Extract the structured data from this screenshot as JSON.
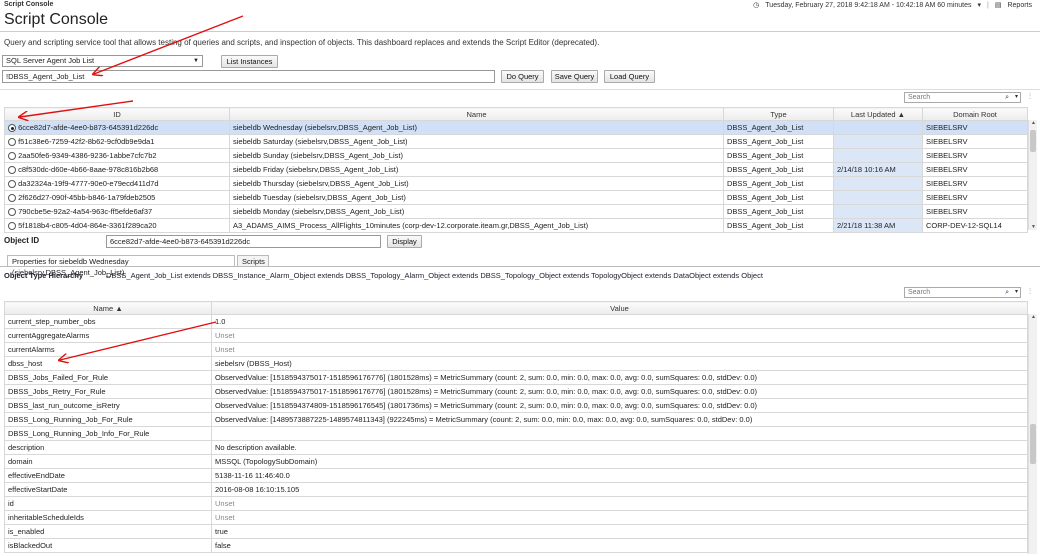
{
  "topbar": {
    "app_title": "Script Console",
    "datetime": "Tuesday, February 27, 2018 9:42:18 AM - 10:42:18 AM 60 minutes",
    "reports": "Reports"
  },
  "page": {
    "title": "Script Console",
    "description": "Query and scripting service tool that allows testing of queries and scripts, and inspection of objects. This dashboard replaces and extends the Script Editor (deprecated)."
  },
  "query": {
    "selected_query": "SQL Server Agent Job List",
    "list_instances_label": "List Instances",
    "query_text": "!DBSS_Agent_Job_List",
    "do_query_label": "Do Query",
    "save_query_label": "Save Query",
    "load_query_label": "Load Query"
  },
  "results": {
    "search_placeholder": "Search",
    "columns": [
      "ID",
      "Name",
      "Type",
      "Last Updated",
      "Domain Root"
    ],
    "sort_column": "Last Updated",
    "rows": [
      {
        "id": "6cce82d7-afde-4ee0-b873-645391d226dc",
        "name": "siebeldb Wednesday (siebelsrv,DBSS_Agent_Job_List)",
        "type": "DBSS_Agent_Job_List",
        "updated": "",
        "domain": "SIEBELSRV",
        "selected": true
      },
      {
        "id": "f51c38e6-7259-42f2-8b62-9cf0db9e9da1",
        "name": "siebeldb Saturday (siebelsrv,DBSS_Agent_Job_List)",
        "type": "DBSS_Agent_Job_List",
        "updated": "",
        "domain": "SIEBELSRV",
        "selected": false
      },
      {
        "id": "2aa50fe6-9349-4386-9236-1abbe7cfc7b2",
        "name": "siebeldb Sunday (siebelsrv,DBSS_Agent_Job_List)",
        "type": "DBSS_Agent_Job_List",
        "updated": "",
        "domain": "SIEBELSRV",
        "selected": false
      },
      {
        "id": "c8f530dc-d60e-4b66-8aae-978c816b2b68",
        "name": "siebeldb Friday (siebelsrv,DBSS_Agent_Job_List)",
        "type": "DBSS_Agent_Job_List",
        "updated": "2/14/18 10:16 AM",
        "domain": "SIEBELSRV",
        "selected": false
      },
      {
        "id": "da32324a-19f9-4777-90e0-e79ecd411d7d",
        "name": "siebeldb Thursday (siebelsrv,DBSS_Agent_Job_List)",
        "type": "DBSS_Agent_Job_List",
        "updated": "",
        "domain": "SIEBELSRV",
        "selected": false
      },
      {
        "id": "2f626d27-090f-45bb-b846-1a79fdeb2505",
        "name": "siebeldb Tuesday (siebelsrv,DBSS_Agent_Job_List)",
        "type": "DBSS_Agent_Job_List",
        "updated": "",
        "domain": "SIEBELSRV",
        "selected": false
      },
      {
        "id": "790cbe5e-92a2-4a54-963c-ff5efde6af37",
        "name": "siebeldb Monday (siebelsrv,DBSS_Agent_Job_List)",
        "type": "DBSS_Agent_Job_List",
        "updated": "",
        "domain": "SIEBELSRV",
        "selected": false
      },
      {
        "id": "5f1818b4-c805-4d04-864e-3361f289ca20",
        "name": "A3_ADAMS_AIMS_Process_AllFlights_10minutes (corp-dev-12.corporate.iteam.gr,DBSS_Agent_Job_List)",
        "type": "DBSS_Agent_Job_List",
        "updated": "2/21/18 11:38 AM",
        "domain": "CORP-DEV-12-SQL14",
        "selected": false
      }
    ]
  },
  "object": {
    "id_label": "Object ID",
    "id_value": "6cce82d7-afde-4ee0-b873-645391d226dc",
    "display_label": "Display",
    "tabs": [
      "Properties for siebeldb Wednesday (siebelsrv,DBSS_Agent_Job_List)",
      "Scripts"
    ],
    "hierarchy_label": "Object Type Hierarchy",
    "hierarchy": "DBSS_Agent_Job_List extends  DBSS_Instance_Alarm_Object extends  DBSS_Topology_Alarm_Object extends  DBSS_Topology_Object extends  TopologyObject extends  DataObject extends  Object"
  },
  "properties": {
    "search_placeholder": "Search",
    "columns": [
      "Name",
      "Value"
    ],
    "rows": [
      {
        "name": "current_step_number_obs",
        "value": "1.0",
        "unset": false
      },
      {
        "name": "currentAggregateAlarms",
        "value": "Unset",
        "unset": true
      },
      {
        "name": "currentAlarms",
        "value": "Unset",
        "unset": true
      },
      {
        "name": "dbss_host",
        "value": "siebelsrv (DBSS_Host)",
        "unset": false
      },
      {
        "name": "DBSS_Jobs_Failed_For_Rule",
        "value": "ObservedValue: [1518594375017-1518596176776] (1801528ms) = MetricSummary (count: 2, sum: 0.0, min: 0.0, max: 0.0, avg: 0.0, sumSquares: 0.0, stdDev: 0.0)",
        "unset": false
      },
      {
        "name": "DBSS_Jobs_Retry_For_Rule",
        "value": "ObservedValue: [1518594375017-1518596176776] (1801528ms) = MetricSummary (count: 2, sum: 0.0, min: 0.0, max: 0.0, avg: 0.0, sumSquares: 0.0, stdDev: 0.0)",
        "unset": false
      },
      {
        "name": "DBSS_last_run_outcome_isRetry",
        "value": "ObservedValue: [1518594374809-1518596176545] (1801736ms) = MetricSummary (count: 2, sum: 0.0, min: 0.0, max: 0.0, avg: 0.0, sumSquares: 0.0, stdDev: 0.0)",
        "unset": false
      },
      {
        "name": "DBSS_Long_Running_Job_For_Rule",
        "value": "ObservedValue: [1489573887225-1489574811343] (922245ms) = MetricSummary (count: 2, sum: 0.0, min: 0.0, max: 0.0, avg: 0.0, sumSquares: 0.0, stdDev: 0.0)",
        "unset": false
      },
      {
        "name": "DBSS_Long_Running_Job_Info_For_Rule",
        "value": "",
        "unset": false
      },
      {
        "name": "description",
        "value": "No description available.",
        "unset": false
      },
      {
        "name": "domain",
        "value": "MSSQL (TopologySubDomain)",
        "unset": false
      },
      {
        "name": "effectiveEndDate",
        "value": "5138-11-16 11:46:40.0",
        "unset": false
      },
      {
        "name": "effectiveStartDate",
        "value": "2016-08-08 16:10:15.105",
        "unset": false
      },
      {
        "name": "id",
        "value": "Unset",
        "unset": true
      },
      {
        "name": "inheritableScheduleIds",
        "value": "Unset",
        "unset": true
      },
      {
        "name": "is_enabled",
        "value": "true",
        "unset": false
      },
      {
        "name": "isBlackedOut",
        "value": "false",
        "unset": false
      }
    ]
  },
  "colors": {
    "selected_row": "#cfe0f7",
    "annotation_arrow": "#e01010"
  }
}
